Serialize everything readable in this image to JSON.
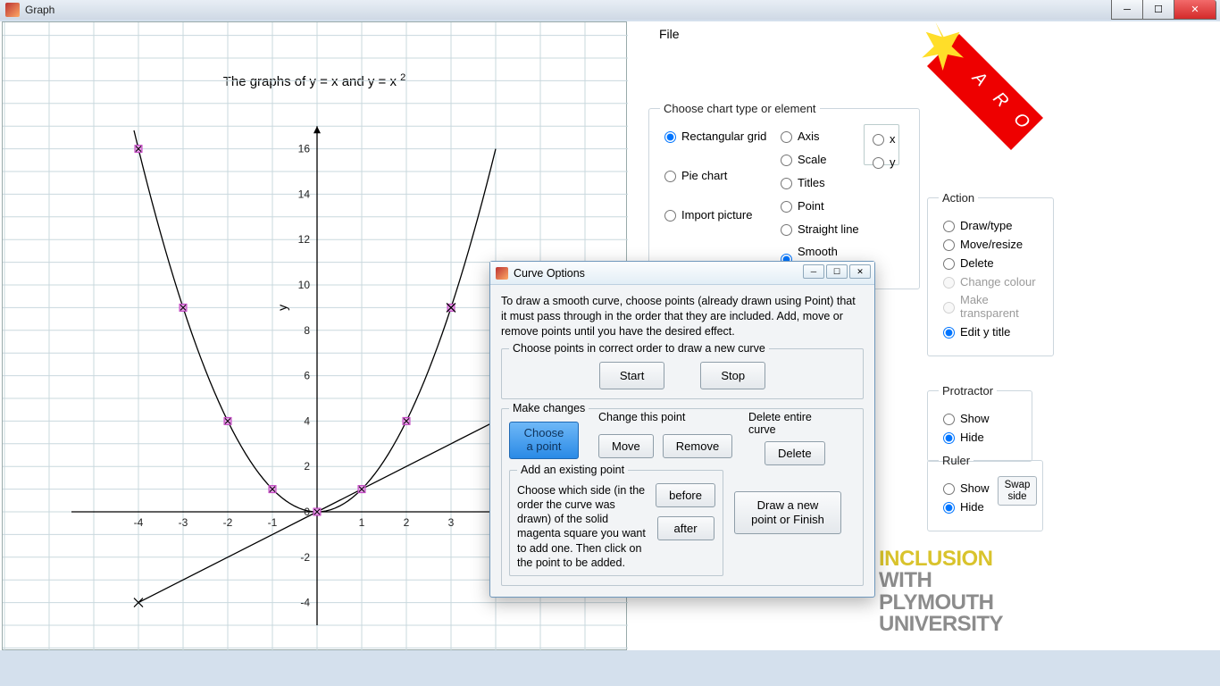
{
  "window": {
    "title": "Graph"
  },
  "chart_data": {
    "type": "line",
    "title": "The graphs of y = x and y = x²",
    "xlabel": "",
    "ylabel": "y",
    "xlim": [
      -5.5,
      5.5
    ],
    "ylim": [
      -5,
      17
    ],
    "xticks": [
      -4,
      -3,
      -2,
      -1,
      0,
      1,
      2,
      3
    ],
    "yticks": [
      -4,
      -2,
      0,
      2,
      4,
      6,
      8,
      10,
      12,
      14,
      16
    ],
    "series": [
      {
        "name": "y = x",
        "x": [
          -4,
          -3,
          -2,
          -1,
          0,
          1,
          2,
          3,
          4
        ],
        "values": [
          -4,
          -3,
          -2,
          -1,
          0,
          1,
          2,
          3,
          4
        ]
      },
      {
        "name": "y = x²",
        "x": [
          -4,
          -3,
          -2,
          -1,
          0,
          1,
          2,
          3,
          4
        ],
        "values": [
          16,
          9,
          4,
          1,
          0,
          1,
          4,
          9,
          16
        ]
      }
    ],
    "points_magenta": [
      [
        -4,
        16
      ],
      [
        -3,
        9
      ],
      [
        -2,
        4
      ],
      [
        -1,
        1
      ],
      [
        0,
        0
      ],
      [
        1,
        1
      ],
      [
        2,
        4
      ],
      [
        3,
        9
      ]
    ],
    "points_x_marker": [
      [
        -4,
        -4
      ],
      [
        3,
        9
      ]
    ]
  },
  "menu": {
    "file": "File"
  },
  "charttype": {
    "legend": "Choose chart type or element",
    "rectangular": "Rectangular grid",
    "pie": "Pie chart",
    "import": "Import picture",
    "axis": "Axis",
    "scale": "Scale",
    "titles": "Titles",
    "point": "Point",
    "straight": "Straight line",
    "smooth": "Smooth curve",
    "x": "x",
    "y": "y"
  },
  "action": {
    "legend": "Action",
    "draw": "Draw/type",
    "move": "Move/resize",
    "delete": "Delete",
    "colour": "Change colour",
    "transparent": "Make transparent",
    "edit_y": "Edit y title"
  },
  "protractor": {
    "legend": "Protractor",
    "show": "Show",
    "hide": "Hide"
  },
  "ruler": {
    "legend": "Ruler",
    "show": "Show",
    "hide": "Hide",
    "swap": "Swap side"
  },
  "dialog": {
    "title": "Curve Options",
    "instructions": "To draw a smooth curve, choose points (already drawn using Point) that it must pass through in the order that they are included. Add, move or remove points until you have the desired effect.",
    "choose_legend": "Choose points in correct order to draw a new curve",
    "start": "Start",
    "stop": "Stop",
    "make_changes": "Make changes",
    "choose_point": "Choose a point",
    "change_this": "Change this point",
    "move": "Move",
    "remove": "Remove",
    "delete_curve": "Delete entire curve",
    "delete": "Delete",
    "add_existing": "Add an existing point",
    "add_text": "Choose which side (in the order the curve was drawn) of the solid magenta square you want to add one.  Then click on the point to be added.",
    "before": "before",
    "after": "after",
    "draw_or_finish": "Draw a new point or Finish"
  },
  "logo": {
    "l1": "INCLUSION",
    "l2": "WITH",
    "l3": "PLYMOUTH",
    "l4": "UNIVERSITY"
  },
  "ribbon": {
    "text": "ARO"
  }
}
